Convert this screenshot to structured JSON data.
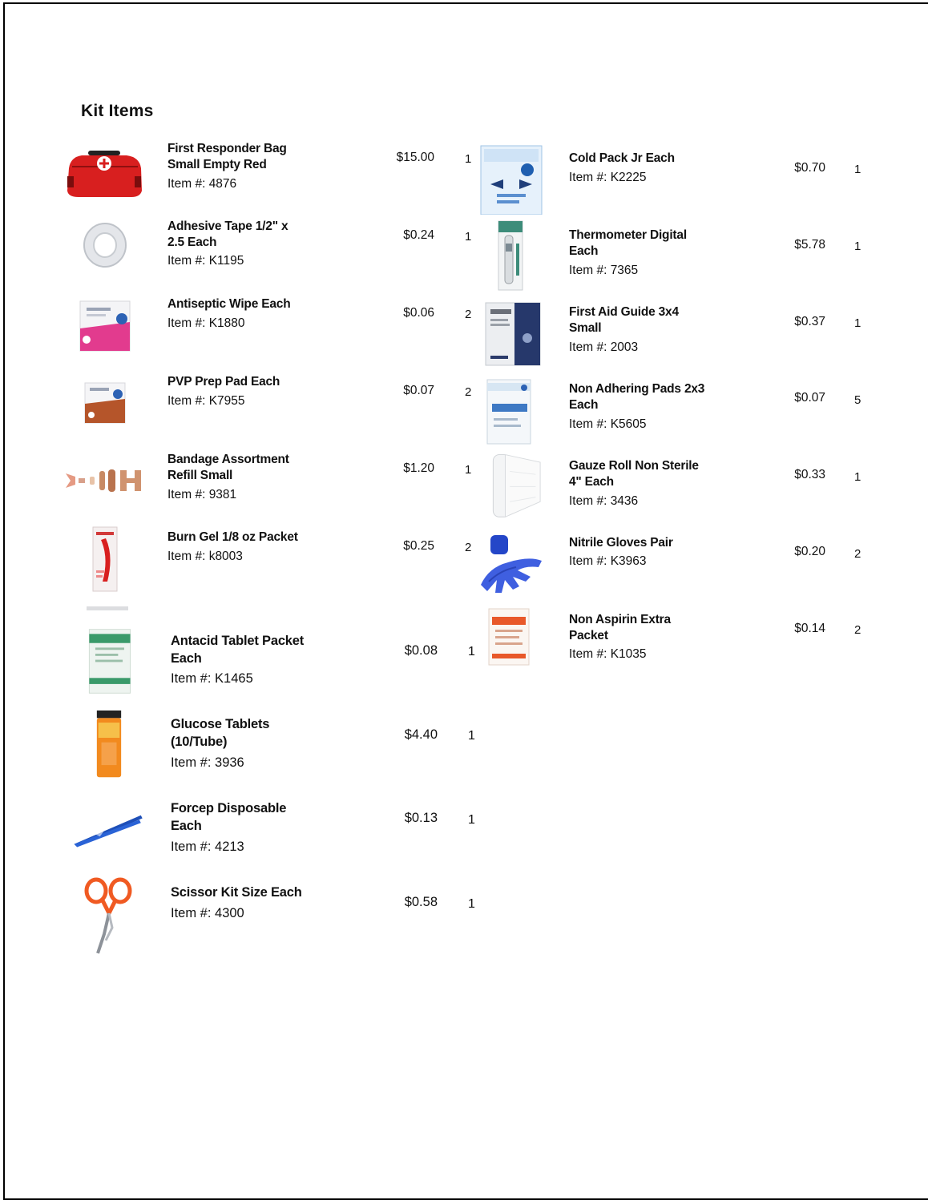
{
  "section_title": "Kit Items",
  "item_label": "Item #: ",
  "left_column": [
    {
      "name": "First Responder Bag\nSmall Empty Red",
      "item_no": "4876",
      "price": "$15.00",
      "qty": "1",
      "icon": "red-first-aid-bag-icon"
    },
    {
      "name": "Adhesive Tape 1/2\" x\n2.5 Each",
      "item_no": "K1195",
      "price": "$0.24",
      "qty": "1",
      "icon": "tape-roll-icon"
    },
    {
      "name": "Antiseptic Wipe Each",
      "item_no": "K1880",
      "price": "$0.06",
      "qty": "2",
      "icon": "antiseptic-wipe-packet-icon"
    },
    {
      "name": "PVP Prep Pad Each",
      "item_no": "K7955",
      "price": "$0.07",
      "qty": "2",
      "icon": "prep-pad-packet-icon"
    },
    {
      "name": "Bandage Assortment\nRefill Small",
      "item_no": "9381",
      "price": "$1.20",
      "qty": "1",
      "icon": "bandages-icon"
    },
    {
      "name": "Burn Gel 1/8 oz Packet",
      "item_no": "k8003",
      "price": "$0.25",
      "qty": "2",
      "icon": "burn-gel-packet-icon"
    },
    {
      "name": "Antacid Tablet Packet\nEach",
      "item_no": "K1465",
      "price": "$0.08",
      "qty": "1",
      "icon": "antacid-packet-icon"
    },
    {
      "name": "Glucose Tablets\n(10/Tube)",
      "item_no": "3936",
      "price": "$4.40",
      "qty": "1",
      "icon": "glucose-tube-icon"
    },
    {
      "name": "Forcep Disposable\nEach",
      "item_no": "4213",
      "price": "$0.13",
      "qty": "1",
      "icon": "forceps-icon"
    },
    {
      "name": "Scissor Kit Size Each",
      "item_no": "4300",
      "price": "$0.58",
      "qty": "1",
      "icon": "scissors-icon"
    }
  ],
  "right_column": [
    {
      "name": "Cold Pack Jr Each",
      "item_no": "K2225",
      "price": "$0.70",
      "qty": "1",
      "icon": "cold-pack-icon"
    },
    {
      "name": "Thermometer Digital\nEach",
      "item_no": "7365",
      "price": "$5.78",
      "qty": "1",
      "icon": "thermometer-icon"
    },
    {
      "name": "First Aid Guide 3x4\nSmall",
      "item_no": "2003",
      "price": "$0.37",
      "qty": "1",
      "icon": "first-aid-guide-icon"
    },
    {
      "name": "Non Adhering Pads 2x3\nEach",
      "item_no": "K5605",
      "price": "$0.07",
      "qty": "5",
      "icon": "gauze-pad-packet-icon"
    },
    {
      "name": "Gauze Roll Non Sterile\n4\" Each",
      "item_no": "3436",
      "price": "$0.33",
      "qty": "1",
      "icon": "gauze-roll-icon"
    },
    {
      "name": "Nitrile Gloves Pair",
      "item_no": "K3963",
      "price": "$0.20",
      "qty": "2",
      "icon": "nitrile-gloves-icon"
    },
    {
      "name": "Non Aspirin Extra\nPacket",
      "item_no": "K1035",
      "price": "$0.14",
      "qty": "2",
      "icon": "non-aspirin-packet-icon"
    }
  ]
}
